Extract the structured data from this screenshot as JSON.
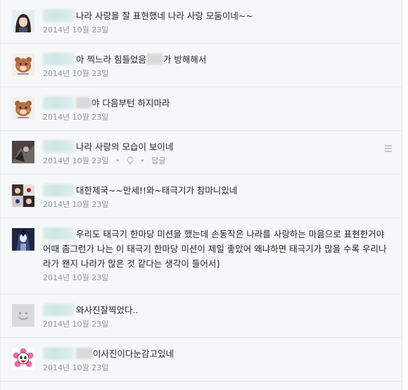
{
  "comments": [
    {
      "avatar": "girl-photo-avatar",
      "text_before": "",
      "text_after": "나라 사랑을 잘 표현했네 나라 사랑 모둠이네~~",
      "date": "2014년 10월 23일"
    },
    {
      "avatar": "bear-character-avatar",
      "text_before": "아 찍느라 힘들었음",
      "text_after": "가 방해해서",
      "date": "2014년 10월 23일"
    },
    {
      "avatar": "bear-character-avatar",
      "text_before": "",
      "text_after": "야 다음부턴 하지마라",
      "date": "2014년 10월 23일"
    },
    {
      "avatar": "photo-avatar",
      "text_before": "",
      "text_after": "나라 사랑의 모습이 보이네",
      "date": "2014년 10월 23일",
      "reply_label": "답글"
    },
    {
      "avatar": "group-photo-avatar",
      "text_before": "",
      "text_after": "대한제국~~만세!!와~태극기가 참마니있네",
      "date": "2014년 10월 23일"
    },
    {
      "avatar": "anime-avatar",
      "text_before": "",
      "text_after": "우리도 태극기 한마당 미션을 했는데 손동작은 나라를 사랑하는 마음으로 표현한거야 어때 좀그런가 나는 이 태극기 한마당 미션이 제일 좋았어 왜냐하면 태극기가 많을 수록 우리나라가 왠지 나라가 많은 것 같다는 생각이 들어서]",
      "date": "2014년 10월 23일"
    },
    {
      "avatar": "default-smiley-avatar",
      "text_before": "",
      "text_after": "와사진잘찍었다..",
      "date": "2014년 10월 23일"
    },
    {
      "avatar": "flower-character-avatar",
      "text_before": "",
      "text_after": "이사진이다눈감고있네",
      "date": "2014년 10월 23일"
    }
  ]
}
